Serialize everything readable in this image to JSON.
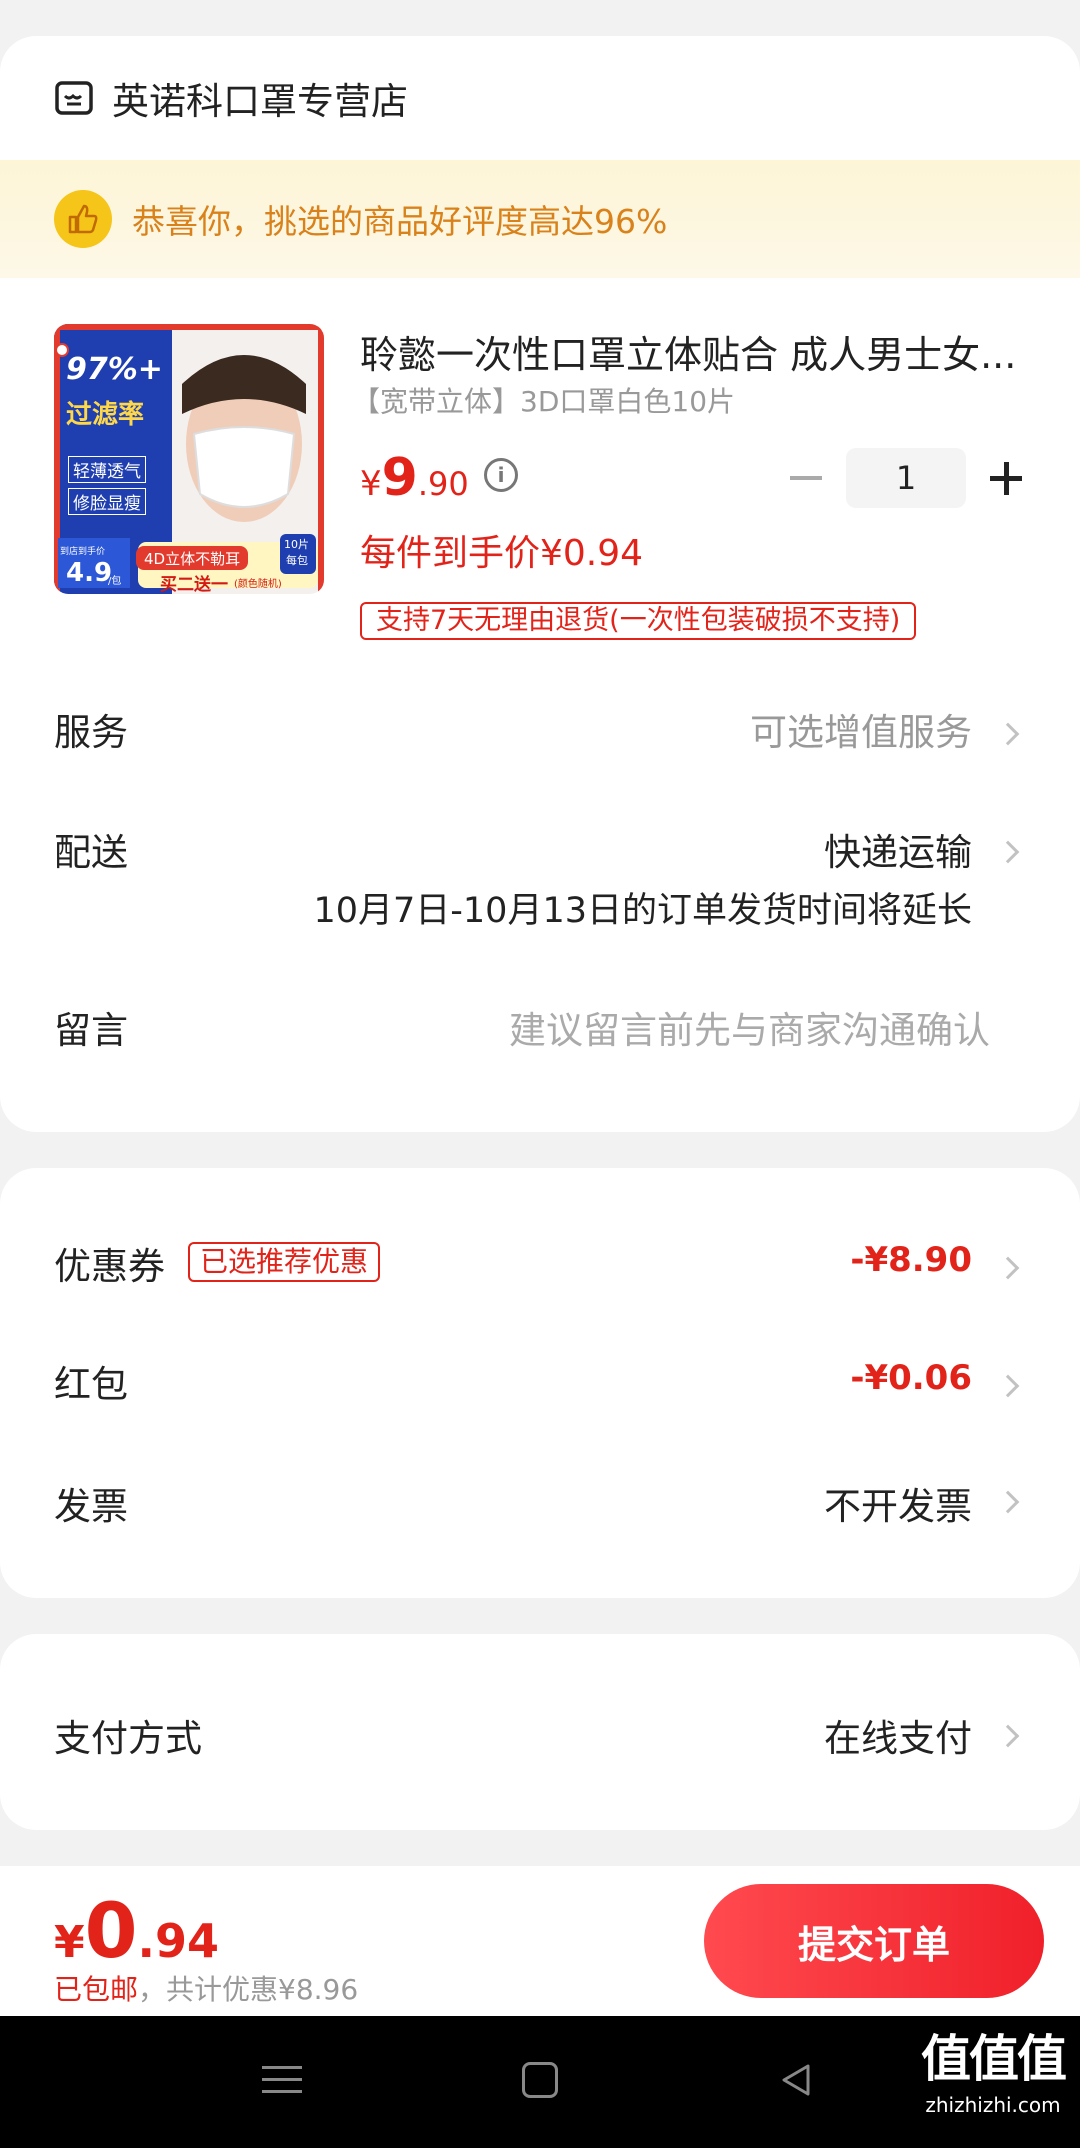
{
  "shop": {
    "name": "英诺科口罩专营店"
  },
  "praise": {
    "text": "恭喜你，挑选的商品好评度高达96%"
  },
  "product": {
    "title": "聆懿一次性口罩立体贴合 成人男士女...",
    "spec": "【宽带立体】3D口罩白色10片",
    "price_symbol": "¥",
    "price_int": "9",
    "price_dec": ".90",
    "quantity": "1",
    "unit_price": "每件到手价¥0.94",
    "return_policy": "支持7天无理由退货(一次性包装破损不支持)",
    "image_texts": {
      "filter": "97%+",
      "filter_sub": "过滤率",
      "feature1": "轻薄透气",
      "feature2": "修脸显瘦",
      "price_tag_label": "到店到手价",
      "price_tag": "4.9",
      "price_tag_unit": "/包",
      "badge1": "4D立体不勒耳",
      "badge2": "买二送一",
      "badge2_sub": "(颜色随机)",
      "pack": "10片",
      "pack_sub": "每包"
    }
  },
  "service": {
    "label": "服务",
    "value": "可选增值服务"
  },
  "delivery": {
    "label": "配送",
    "value": "快递运输",
    "notice": "10月7日-10月13日的订单发货时间将延长"
  },
  "message": {
    "label": "留言",
    "placeholder": "建议留言前先与商家沟通确认"
  },
  "coupon": {
    "label": "优惠券",
    "tag": "已选推荐优惠",
    "value": "-¥8.90"
  },
  "redpacket": {
    "label": "红包",
    "value": "-¥0.06"
  },
  "invoice": {
    "label": "发票",
    "value": "不开发票"
  },
  "payment": {
    "label": "支付方式",
    "value": "在线支付"
  },
  "footer": {
    "total_symbol": "¥",
    "total_int": "0",
    "total_dec": ".94",
    "shipping": "已包邮",
    "discount": "，共计优惠¥8.96",
    "submit_label": "提交订单"
  },
  "watermark": {
    "main": "值值值",
    "sub": "zhizhizhi.com"
  },
  "colors": {
    "accent": "#e2231a",
    "praise_bg": "#fdf5d6",
    "praise_text": "#d9821b",
    "submit": "#f52a32"
  }
}
